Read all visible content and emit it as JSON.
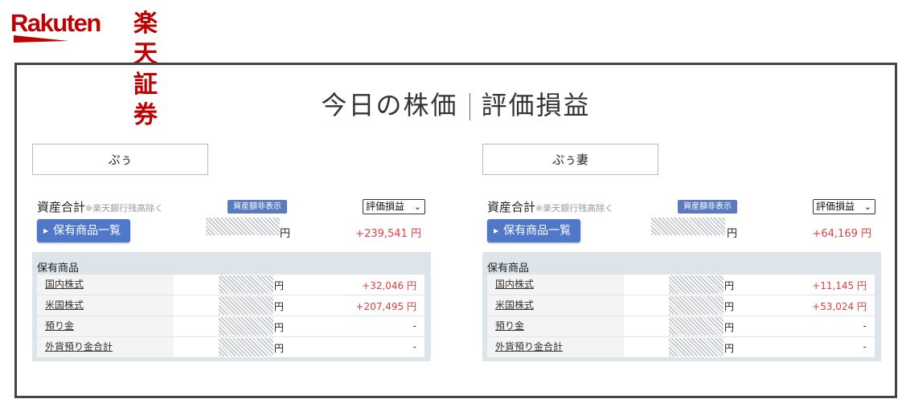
{
  "brand": {
    "name_en": "Rakuten",
    "name_jp": "楽天証券",
    "color": "#bf0000"
  },
  "page": {
    "title_left": "今日の株価",
    "title_right": "評価損益"
  },
  "accounts": [
    {
      "name": "ぷぅ",
      "summary": {
        "label": "資産合計",
        "note": "※楽天銀行残高除く",
        "hide_badge": "資産額非表示",
        "select_value": "評価損益",
        "holdings_button": "保有商品一覧",
        "total_yen_unit": "円",
        "total_pl": "+239,541 円"
      },
      "holdings": {
        "header": "保有商品",
        "rows": [
          {
            "name": "国内株式",
            "unit": "円",
            "pl": "+32,046 円"
          },
          {
            "name": "米国株式",
            "unit": "円",
            "pl": "+207,495 円"
          },
          {
            "name": "預り金",
            "unit": "円",
            "pl": "-"
          },
          {
            "name": "外貨預り金合計",
            "unit": "円",
            "pl": "-"
          }
        ]
      }
    },
    {
      "name": "ぷぅ妻",
      "summary": {
        "label": "資産合計",
        "note": "※楽天銀行残高除く",
        "hide_badge": "資産額非表示",
        "select_value": "評価損益",
        "holdings_button": "保有商品一覧",
        "total_yen_unit": "円",
        "total_pl": "+64,169 円"
      },
      "holdings": {
        "header": "保有商品",
        "rows": [
          {
            "name": "国内株式",
            "unit": "円",
            "pl": "+11,145 円"
          },
          {
            "name": "米国株式",
            "unit": "円",
            "pl": "+53,024 円"
          },
          {
            "name": "預り金",
            "unit": "円",
            "pl": "-"
          },
          {
            "name": "外貨預り金合計",
            "unit": "円",
            "pl": "-"
          }
        ]
      }
    }
  ],
  "colors": {
    "profit": "#e04040",
    "button": "#5078c8",
    "badge": "#5a7bc0"
  }
}
